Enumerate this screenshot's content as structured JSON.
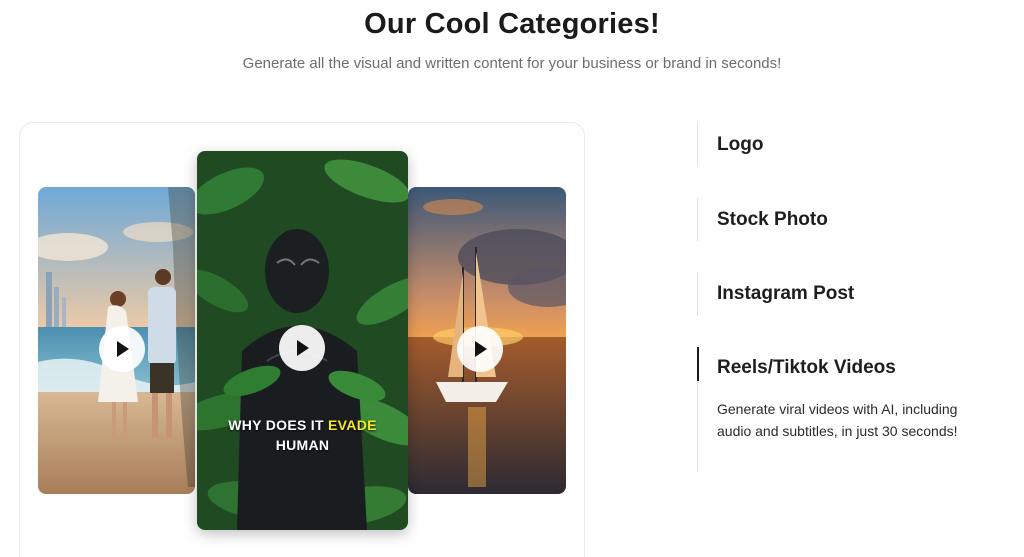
{
  "section": {
    "title": "Our Cool Categories!",
    "subtitle": "Generate all the visual and written content for your business or brand in seconds!"
  },
  "cards": {
    "center_caption_line1": "WHY DOES IT",
    "center_caption_highlight": "EVADE",
    "center_caption_line2": "HUMAN",
    "highlight_color": "#f5e72a"
  },
  "categories": [
    {
      "title": "Logo",
      "active": false
    },
    {
      "title": "Stock Photo",
      "active": false
    },
    {
      "title": "Instagram Post",
      "active": false
    },
    {
      "title": "Reels/Tiktok Videos",
      "active": true,
      "description": "Generate viral videos with AI, including audio and subtitles, in just 30 seconds!"
    }
  ],
  "icons": {
    "play": "play-icon"
  }
}
